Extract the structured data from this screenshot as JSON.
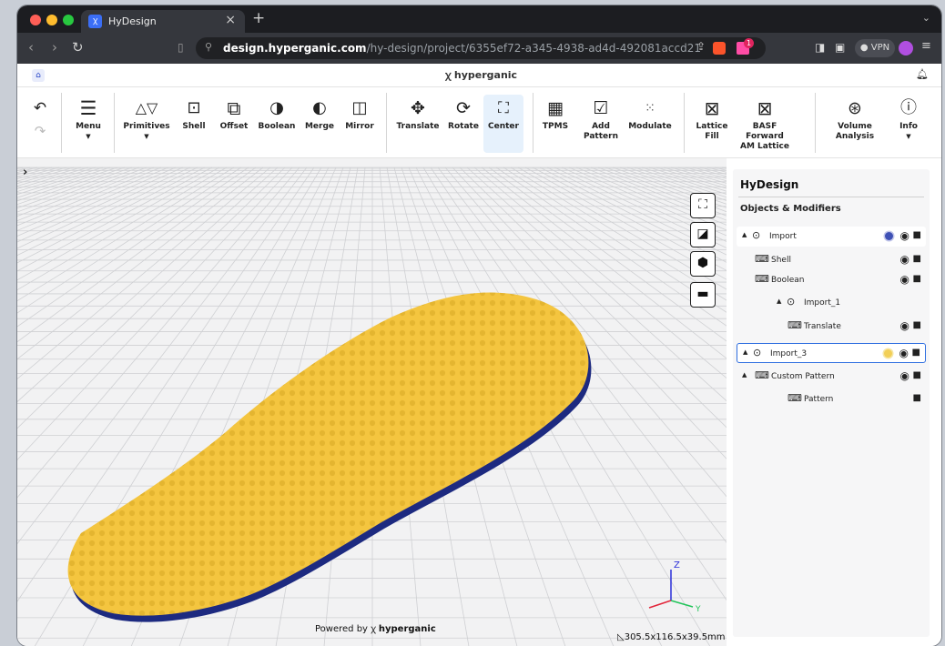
{
  "browser": {
    "tab_title": "HyDesign",
    "tab_close": "×",
    "new_tab": "+",
    "url_host": "design.hyperganic.com",
    "url_path": "/hy-design/project/6355ef72-a345-4938-ad4d-492081accd21",
    "vpn_label": "VPN",
    "brave_badge": "1"
  },
  "app": {
    "brand": "hyperganic",
    "powered_by_prefix": "Powered by",
    "powered_by_brand": "hyperganic",
    "dimensions": "305.5x116.5x39.5mm"
  },
  "toolbar": {
    "undo": "Undo",
    "menu": "Menu",
    "primitives": "Primitives",
    "shell": "Shell",
    "offset": "Offset",
    "boolean": "Boolean",
    "merge": "Merge",
    "mirror": "Mirror",
    "translate": "Translate",
    "rotate": "Rotate",
    "center": "Center",
    "tpms": "TPMS",
    "add_pattern_1": "Add",
    "add_pattern_2": "Pattern",
    "modulate": "Modulate",
    "lattice_fill_1": "Lattice",
    "lattice_fill_2": "Fill",
    "basf_1": "BASF Forward",
    "basf_2": "AM Lattice",
    "volume_1": "Volume",
    "volume_2": "Analysis",
    "info": "Info"
  },
  "panel": {
    "title": "HyDesign",
    "subtitle": "Objects & Modifiers",
    "items": [
      {
        "name": "Import",
        "dot_color": "#3f51b5"
      },
      {
        "name": "Shell"
      },
      {
        "name": "Boolean"
      },
      {
        "name": "Import_1"
      },
      {
        "name": "Translate"
      },
      {
        "name": "Import_3",
        "dot_color": "#f2cf57"
      },
      {
        "name": "Custom Pattern"
      },
      {
        "name": "Pattern"
      }
    ]
  },
  "axes": {
    "z": "Z",
    "y": "Y"
  },
  "colors": {
    "accent": "#2f6fe0",
    "model_top": "#f4c53f",
    "model_base": "#1d2a80",
    "active_tool_bg": "#e6f1fc"
  },
  "icons": {
    "home": "home-icon",
    "bell": "bell-icon",
    "undo": "undo-icon",
    "redo": "redo-icon",
    "menu": "hamburger-icon",
    "eye": "eye-icon",
    "trash": "trash-icon"
  }
}
